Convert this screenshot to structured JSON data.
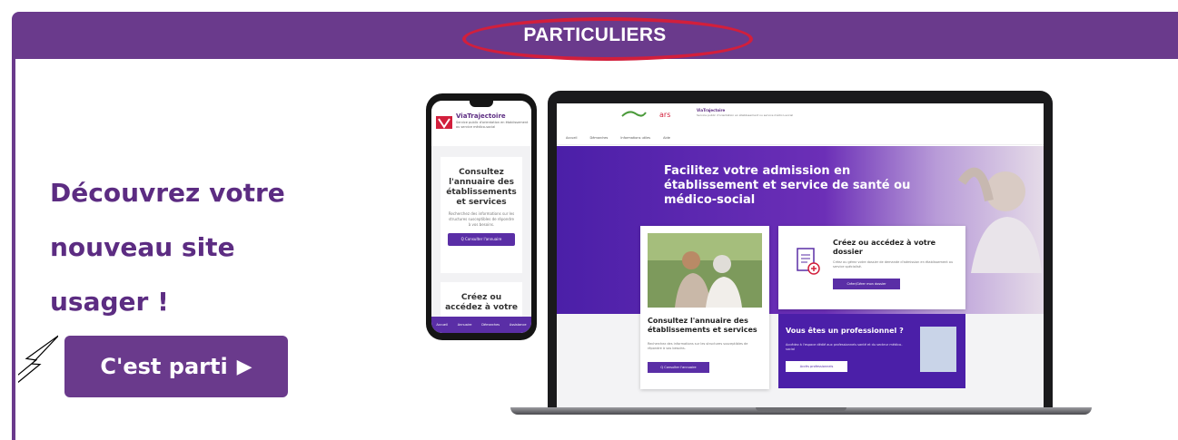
{
  "header": {
    "title": "PARTICULIERS"
  },
  "hero_text": {
    "headline": "Découvrez votre nouveau site usager !"
  },
  "cta": {
    "label": "C'est parti",
    "arrow": "▶"
  },
  "phone_screen": {
    "brand": "ViaTrajectoire",
    "subtitle": "Service public d'orientation en établissement ou service médico-social",
    "card1_title": "Consultez l'annuaire des établissements et services",
    "card1_text": "Recherchez des informations sur les structures susceptibles de répondre à vos besoins.",
    "card1_button": "Q Consulter l'annuaire",
    "card2_title": "Créez ou accédez à votre",
    "nav": [
      "Accueil",
      "Annuaire",
      "Démarches",
      "Assistance"
    ]
  },
  "laptop_screen": {
    "brand": "ViaTrajectoire",
    "brand_sub": "Service public d'orientation en établissement ou service médico-social",
    "menu": [
      "Accueil",
      "Démarches",
      "Informations utiles",
      "Aide"
    ],
    "hero_title": "Facilitez votre admission en établissement et service de santé ou médico-social",
    "card_annuaire": {
      "title": "Consultez l'annuaire des établissements et services",
      "text": "Recherchez des informations sur les structures susceptibles de répondre à vos besoins.",
      "button": "Q Consulter l'annuaire"
    },
    "card_dossier": {
      "title": "Créez ou accédez à votre dossier",
      "text": "Créez ou gérez votre dossier de demande d'admission en établissement ou service spécialisé.",
      "button": "Créer/Gérer mon dossier"
    },
    "card_pro": {
      "title": "Vous êtes un professionnel ?",
      "text": "Accédez à l'espace dédié aux professionnels santé et du secteur médico-social",
      "button": "Accès professionnels"
    }
  },
  "colors": {
    "frame_purple": "#6a3a8c",
    "headline_purple": "#5c2c82",
    "ellipse_red": "#d21f3c",
    "site_purple": "#5a2ea6"
  }
}
